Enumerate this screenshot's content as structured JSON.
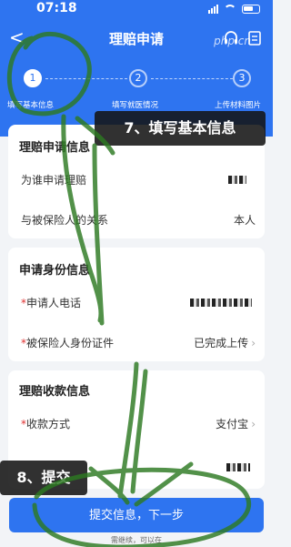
{
  "status": {
    "time": "07:18"
  },
  "nav": {
    "back": "<",
    "title": "理赔申请"
  },
  "watermark": "php.cn",
  "steps": [
    {
      "num": "1",
      "label": "填写基本信息"
    },
    {
      "num": "2",
      "label": "填写就医情况"
    },
    {
      "num": "3",
      "label": "上传材料图片"
    }
  ],
  "annotations": {
    "step7": "7、填写基本信息",
    "step8": "8、提交"
  },
  "claim_info": {
    "title": "理赔申请信息",
    "rows": [
      {
        "label": "为谁申请理赔",
        "value": ""
      },
      {
        "label": "与被保险人的关系",
        "value": "本人"
      }
    ]
  },
  "identity_info": {
    "title": "申请身份信息",
    "rows": [
      {
        "label": "申请人电话",
        "value": ""
      },
      {
        "label": "被保险人身份证件",
        "value": "已完成上传"
      }
    ]
  },
  "payment_info": {
    "title": "理赔收款信息",
    "rows": [
      {
        "label": "收款方式",
        "value": "支付宝"
      }
    ]
  },
  "submit_label": "提交信息，下一步",
  "footnote": {
    "text": "需继续，可以在",
    "link": ""
  }
}
